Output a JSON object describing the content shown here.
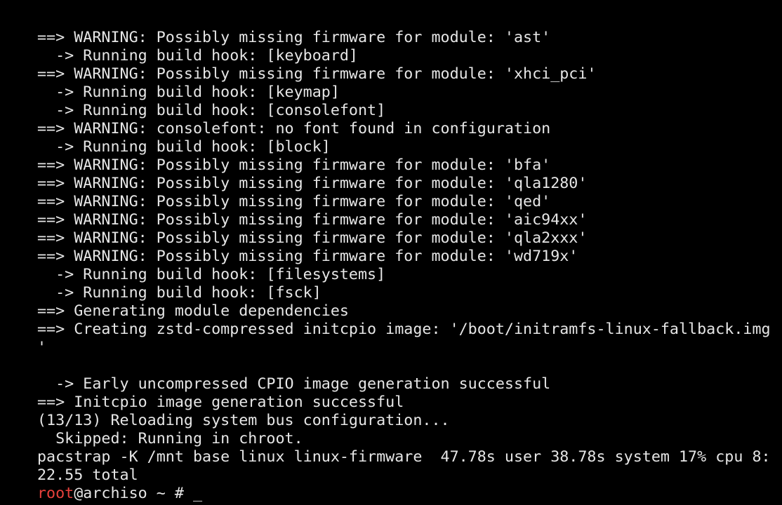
{
  "terminal": {
    "lines": [
      "==> WARNING: Possibly missing firmware for module: 'ast'",
      "  -> Running build hook: [keyboard]",
      "==> WARNING: Possibly missing firmware for module: 'xhci_pci'",
      "  -> Running build hook: [keymap]",
      "  -> Running build hook: [consolefont]",
      "==> WARNING: consolefont: no font found in configuration",
      "  -> Running build hook: [block]",
      "==> WARNING: Possibly missing firmware for module: 'bfa'",
      "==> WARNING: Possibly missing firmware for module: 'qla1280'",
      "==> WARNING: Possibly missing firmware for module: 'qed'",
      "==> WARNING: Possibly missing firmware for module: 'aic94xx'",
      "==> WARNING: Possibly missing firmware for module: 'qla2xxx'",
      "==> WARNING: Possibly missing firmware for module: 'wd719x'",
      "  -> Running build hook: [filesystems]",
      "  -> Running build hook: [fsck]",
      "==> Generating module dependencies",
      "==> Creating zstd-compressed initcpio image: '/boot/initramfs-linux-fallback.img",
      "'",
      "",
      "  -> Early uncompressed CPIO image generation successful",
      "==> Initcpio image generation successful",
      "(13/13) Reloading system bus configuration...",
      "  Skipped: Running in chroot.",
      "pacstrap -K /mnt base linux linux-firmware  47.78s user 38.78s system 17% cpu 8:",
      "22.55 total"
    ],
    "prompt": {
      "user": "root",
      "host_part": "@archiso ~ # ",
      "cursor": "_"
    }
  },
  "colors": {
    "background": "#000000",
    "text": "#e6e6e6",
    "prompt_user": "#e8413c"
  }
}
